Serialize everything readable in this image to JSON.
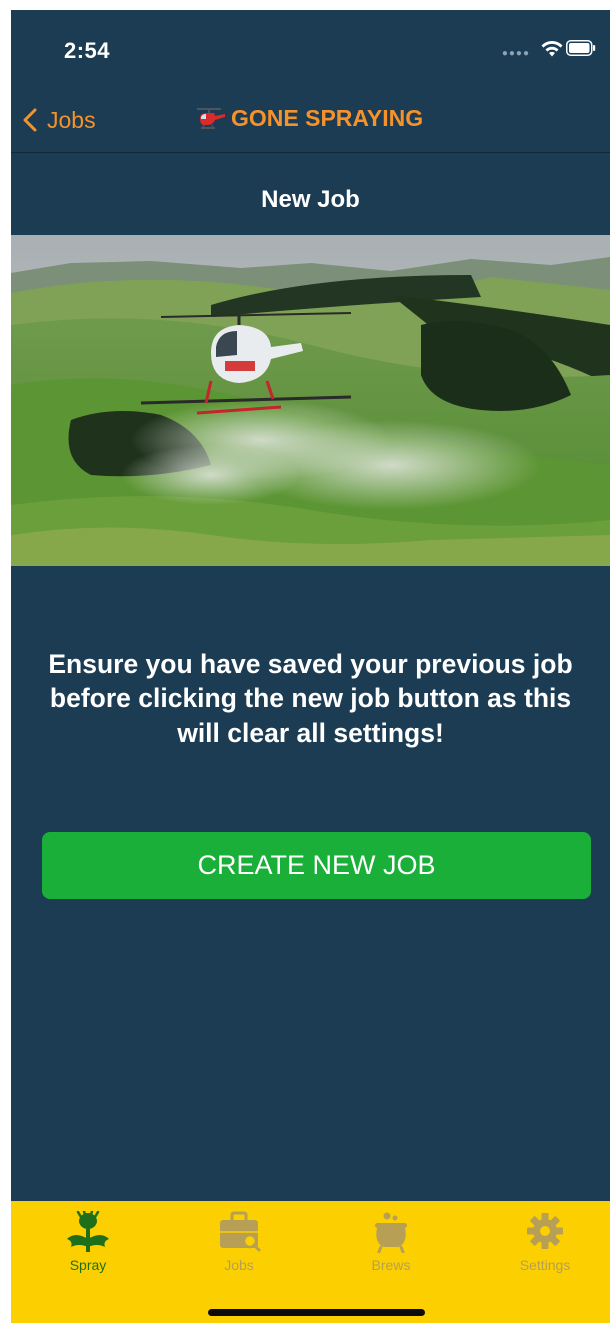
{
  "status_bar": {
    "time": "2:54"
  },
  "nav": {
    "back_label": "Jobs",
    "title": "GONE SPRAYING"
  },
  "page": {
    "title": "New Job"
  },
  "warning": {
    "text": "Ensure you have saved your previous job before clicking the new job button as this will clear all settings!"
  },
  "create_button": {
    "label": "CREATE NEW JOB"
  },
  "tabs": [
    {
      "label": "Spray",
      "icon": "thistle-icon",
      "active": true
    },
    {
      "label": "Jobs",
      "icon": "briefcase-icon",
      "active": false
    },
    {
      "label": "Brews",
      "icon": "cauldron-icon",
      "active": false
    },
    {
      "label": "Settings",
      "icon": "gear-icon",
      "active": false
    }
  ],
  "colors": {
    "background": "#1b3c53",
    "accent": "#f5922b",
    "button": "#1aaf38",
    "tab_bar": "#fcd000",
    "tab_active": "#1f6f1a",
    "tab_inactive": "#b79f55"
  }
}
